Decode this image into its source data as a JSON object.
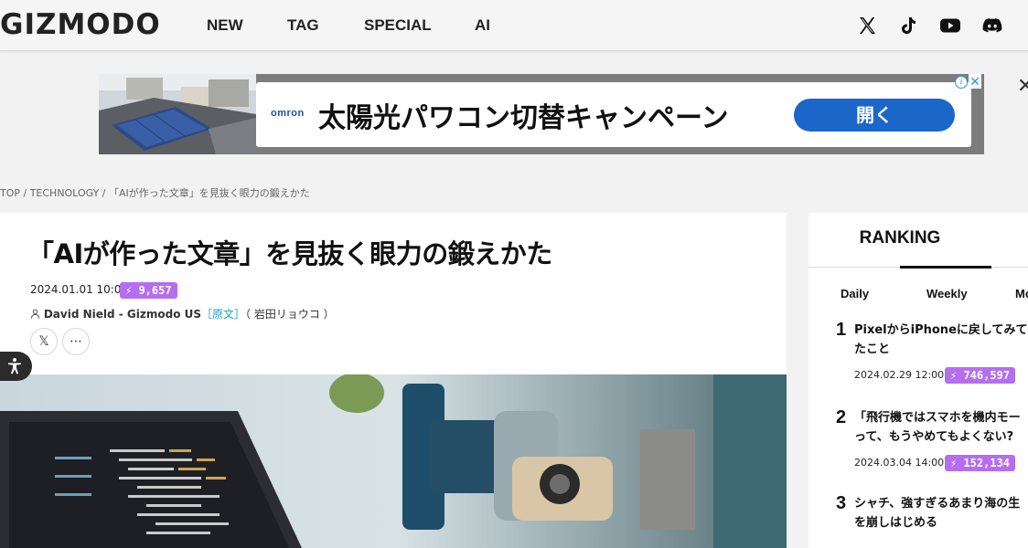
{
  "header": {
    "logo": "GIZMODO",
    "nav": [
      {
        "label": "NEW"
      },
      {
        "label": "TAG"
      },
      {
        "label": "SPECIAL"
      },
      {
        "label": "AI"
      }
    ],
    "social_icons": [
      "x-icon",
      "tiktok-icon",
      "youtube-icon",
      "discord-icon"
    ]
  },
  "ad": {
    "brand": "omron",
    "headline": "太陽光パワコン切替キャンペーン",
    "cta": "開く",
    "info": "i",
    "close": "✕",
    "outer_close": "✕"
  },
  "breadcrumb": "TOP / TECHNOLOGY / 「AIが作った文章」を見抜く眼力の鍛えかた",
  "article": {
    "title": "「AIが作った文章」を見抜く眼力の鍛えかた",
    "date": "2024.01.01 10:00",
    "views": "⚡ 9,657",
    "author": "David Nield - Gizmodo US",
    "original_link": "［原文］",
    "translator": "（ 岩田リョウコ ）",
    "share_x": "𝕏",
    "share_more": "⋯"
  },
  "ranking": {
    "title": "RANKING",
    "tabs": [
      {
        "label": "Daily"
      },
      {
        "label": "Weekly"
      },
      {
        "label": "Mo"
      }
    ],
    "items": [
      {
        "rank": "1",
        "text": "PixelからiPhoneに戻してみて感\nたこと",
        "date": "2024.02.29 12:00",
        "views": "⚡ 746,597"
      },
      {
        "rank": "2",
        "text": "「飛行機ではスマホを機内モー\nって、もうやめてもよくない?",
        "date": "2024.03.04 14:00",
        "views": "⚡ 152,134"
      },
      {
        "rank": "3",
        "text": "シャチ、強すぎるあまり海の生\nを崩しはじめる",
        "date": "",
        "views": ""
      }
    ]
  },
  "colors": {
    "badge": "#b66ef0",
    "cta": "#1b66c9",
    "link": "#1aa0c8"
  }
}
